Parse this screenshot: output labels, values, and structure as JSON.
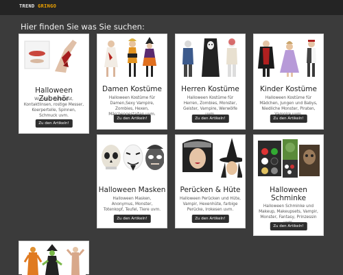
{
  "brand": {
    "part1": "TREND ",
    "part2": "GRINGO"
  },
  "heading": "Hier finden Sie was Sie suchen:",
  "cards": [
    {
      "title": "Halloween Zubehör",
      "desc": "Wunden, Kunstblut, Kontaktlinsen, rostige Messer, Koerpertelle, Spinnen, Schmuck uvm.",
      "button": "Zu den Artikeln!"
    },
    {
      "title": "Damen Kostüme",
      "desc": "Halloween Kostüme für Damen,Sexy Vampire, Zombies, Hexen, Märchengestalten uvm.",
      "button": "Zu den Artikeln!"
    },
    {
      "title": "Herren Kostüme",
      "desc": "Halloween Kostüme für Herren, Zombies, Monster, Geister, Vampire, Werwölfe uvm.",
      "button": "Zu den Artikeln!"
    },
    {
      "title": "Kinder Kostüme",
      "desc": "Halloween Kostüme für Mädchen, Jungen und Babys, Niedliche Monster, Piraten, Vampire uvm.",
      "button": "Zu den Artikeln!"
    },
    {
      "title": "Halloween Masken",
      "desc": "Halloween Masken, Anonymus, Monster, Totenkopf, Teufel, Tiere uvm.",
      "button": "Zu den Artikeln!"
    },
    {
      "title": "Perücken & Hüte",
      "desc": "Halloween Perücken und Hüte, Vampir, Hexenhüte, farbige Perücke, Irokesen uvm.",
      "button": "Zu den Artikeln!"
    },
    {
      "title1": "Halloween",
      "title2": "Schminke",
      "desc": "Halloween Schminke und Makeup, Makeupsets, Vampir, Monster, Fantasy, Prinzessin uvm.",
      "button": "Zu den Artikeln!"
    }
  ]
}
